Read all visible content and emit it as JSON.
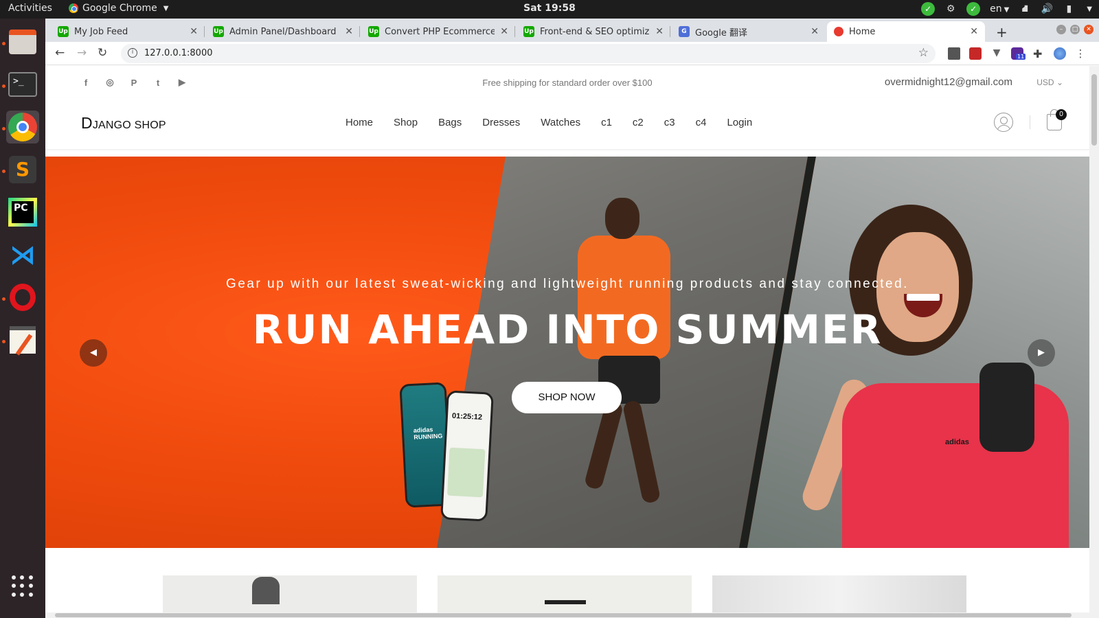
{
  "system": {
    "activities": "Activities",
    "app_name": "Google Chrome",
    "clock": "Sat 19:58",
    "language": "en",
    "tray_icons": [
      "check-icon",
      "steam-icon",
      "check-icon",
      "network-icon",
      "volume-icon",
      "battery-icon"
    ]
  },
  "dock": {
    "items": [
      "files",
      "terminal",
      "chrome",
      "sublime-text",
      "pycharm",
      "vscode",
      "opera",
      "text-editor"
    ]
  },
  "browser": {
    "tabs": [
      {
        "title": "My Job Feed",
        "favicon": "Up"
      },
      {
        "title": "Admin Panel/Dashboard",
        "favicon": "Up"
      },
      {
        "title": "Convert PHP Ecommerce",
        "favicon": "Up"
      },
      {
        "title": "Front-end & SEO optimiz",
        "favicon": "Up"
      },
      {
        "title": "Google 翻译",
        "favicon": "G"
      },
      {
        "title": "Home",
        "favicon": "",
        "active": true
      }
    ],
    "url": "127.0.0.1:8000",
    "extension_badge": "11"
  },
  "site": {
    "social_icons": [
      "facebook-icon",
      "instagram-icon",
      "pinterest-icon",
      "twitter-icon",
      "youtube-icon"
    ],
    "shipping_notice": "Free shipping for standard order over $100",
    "account_email": "overmidnight12@gmail.com",
    "currency": "USD",
    "logo_initial": "D",
    "logo_rest": "JANGO SHOP",
    "menu": [
      "Home",
      "Shop",
      "Bags",
      "Dresses",
      "Watches",
      "c1",
      "c2",
      "c3",
      "c4",
      "Login"
    ],
    "cart_count": "0",
    "hero": {
      "subtitle": "Gear up with our latest sweat-wicking and lightweight running products and stay connected.",
      "title": "RUN AHEAD INTO SUMMER",
      "button": "SHOP NOW",
      "phone_time": "01:25:12",
      "phone_brand": "adidas",
      "phone_app": "RUNNING",
      "shirt_brand": "adidas"
    },
    "colors": {
      "hero_orange": "#f04a0c",
      "accent": "#e95420"
    }
  }
}
